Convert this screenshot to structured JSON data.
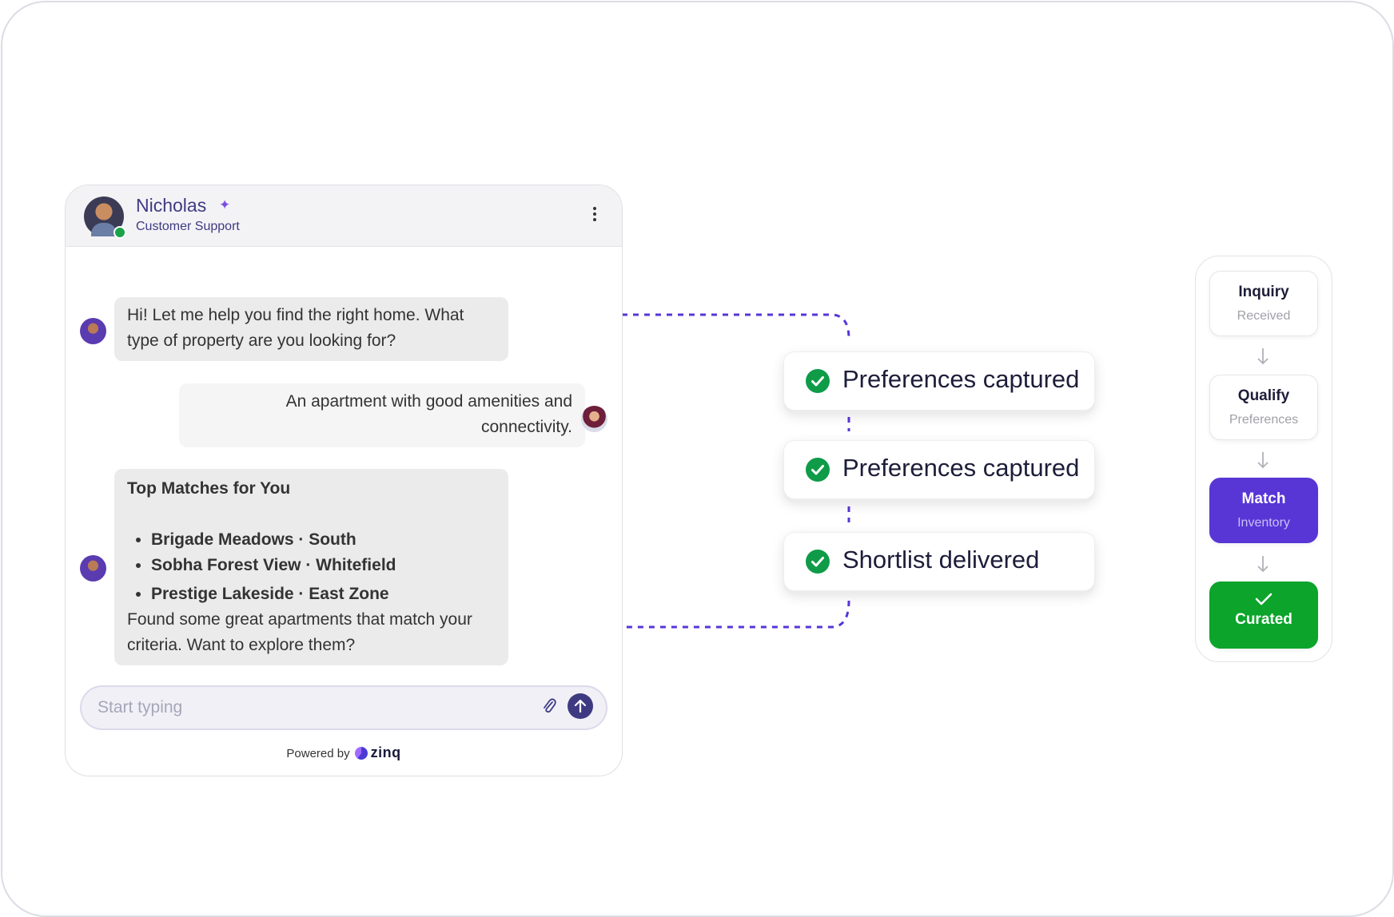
{
  "chat": {
    "agent_name": "Nicholas",
    "agent_role": "Customer Support",
    "messages": {
      "bot_greeting": "Hi! Let me help you find the right home. What type of property are you looking for?",
      "user_reply": "An apartment with good amenities and connectivity.",
      "matches_title": "Top Matches for You",
      "matches": [
        "Brigade Meadows · South",
        "Sobha Forest View · Whitefield",
        "Prestige Lakeside · East Zone"
      ],
      "matches_followup": "Found some great apartments that match your criteria. Want to explore them?"
    },
    "input": {
      "placeholder": "Start typing",
      "value": ""
    },
    "powered_by": "Powered by",
    "brand": "zinq"
  },
  "status_cards": [
    "Preferences captured",
    "Preferences captured",
    "Shortlist delivered"
  ],
  "pipeline": {
    "stages": [
      {
        "title": "Inquiry",
        "subtitle": "Received",
        "state": "default"
      },
      {
        "title": "Qualify",
        "subtitle": "Preferences",
        "state": "default"
      },
      {
        "title": "Match",
        "subtitle": "Inventory",
        "state": "active"
      },
      {
        "title": "Curated",
        "subtitle": "",
        "state": "done"
      }
    ]
  },
  "colors": {
    "accent": "#5836d6",
    "brand_navy": "#3e3a82",
    "success": "#0f9b48",
    "connector": "#5836d6"
  },
  "icons": [
    "sparkle-icon",
    "kebab-menu-icon",
    "paperclip-icon",
    "arrow-up-icon",
    "check-icon",
    "arrow-down-icon"
  ]
}
